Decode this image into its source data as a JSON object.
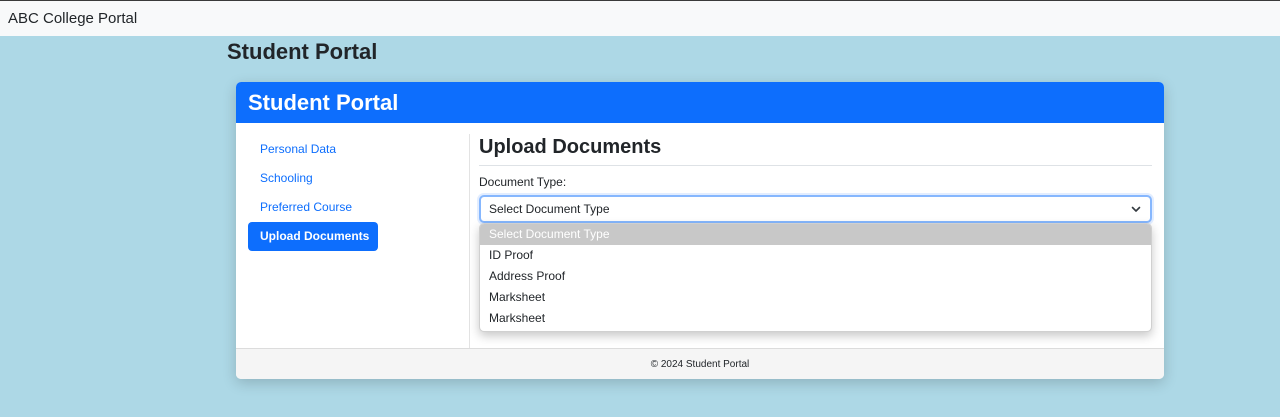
{
  "navbar": {
    "brand": "ABC College Portal"
  },
  "page": {
    "title": "Student Portal"
  },
  "card": {
    "header_title": "Student Portal",
    "footer_text": "© 2024 Student Portal"
  },
  "sidebar": {
    "items": [
      {
        "label": "Personal Data",
        "active": false
      },
      {
        "label": "Schooling",
        "active": false
      },
      {
        "label": "Preferred Course",
        "active": false
      },
      {
        "label": "Upload Documents",
        "active": true
      }
    ]
  },
  "upload": {
    "title": "Upload Documents",
    "document_type_label": "Document Type:",
    "select_value": "Select Document Type",
    "options": [
      "Select Document Type",
      "ID Proof",
      "Address Proof",
      "Marksheet",
      "Marksheet"
    ],
    "selected_option_index": 0
  },
  "colors": {
    "background": "#add8e6",
    "primary": "#0d6efd",
    "navbar_bg": "#f8f9fa",
    "selected_option_bg": "#c8c8c8"
  },
  "icons": {
    "select_chevron": "chevron-down-icon"
  }
}
